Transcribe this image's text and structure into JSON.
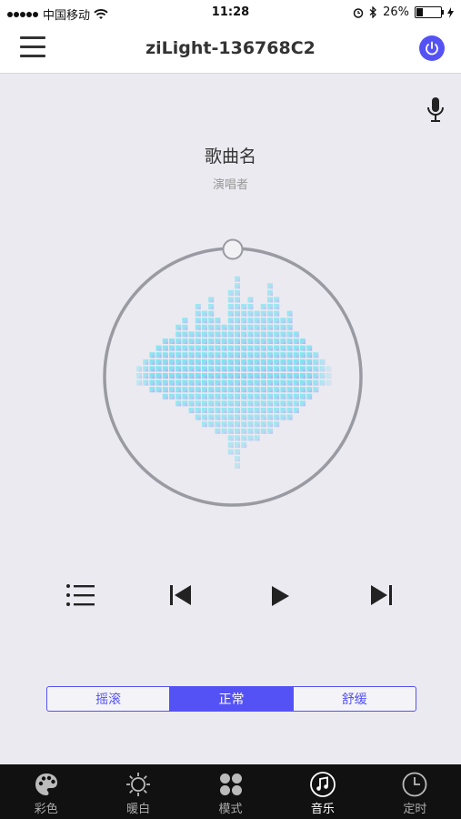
{
  "status_bar": {
    "carrier": "中国移动",
    "time": "11:28",
    "battery": "26%",
    "battery_level": 0.26
  },
  "header": {
    "title": "ziLight-136768C2"
  },
  "player": {
    "song_title": "歌曲名",
    "artist": "演唱者"
  },
  "modes": [
    {
      "label": "摇滚",
      "active": false
    },
    {
      "label": "正常",
      "active": true
    },
    {
      "label": "舒缓",
      "active": false
    }
  ],
  "tabs": [
    {
      "label": "彩色",
      "icon": "palette-icon"
    },
    {
      "label": "暖白",
      "icon": "sun-icon"
    },
    {
      "label": "模式",
      "icon": "modes-icon"
    },
    {
      "label": "音乐",
      "icon": "music-icon",
      "active": true
    },
    {
      "label": "定时",
      "icon": "clock-icon"
    }
  ],
  "colors": {
    "accent": "#5552f5",
    "viz_cyan": "#4ff3f0",
    "viz_purple": "#b49cf0"
  }
}
